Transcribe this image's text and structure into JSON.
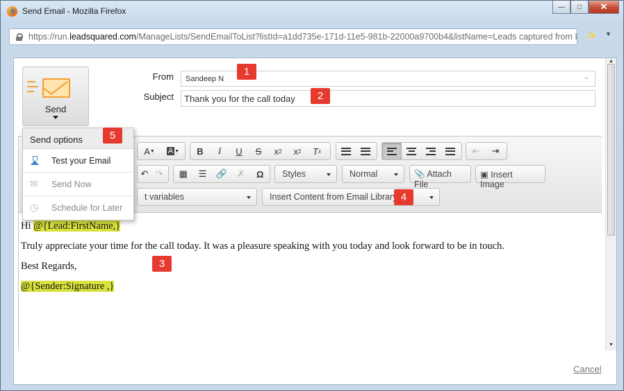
{
  "window": {
    "title": "Send Email - Mozilla Firefox",
    "url_scheme": "https://run.",
    "url_domain": "leadsquared.com",
    "url_path": "/ManageLists/SendEmailToList?listId=a1dd735e-171d-11e5-981b-22000a9700b4&listName=Leads captured from Inbour"
  },
  "send_button": {
    "label": "Send"
  },
  "form": {
    "from_label": "From",
    "from_value": "Sandeep N",
    "subject_label": "Subject",
    "subject_value": "Thank you for the call today"
  },
  "toolbar": {
    "styles_label": "Styles",
    "format_label": "Normal",
    "attach_label": "Attach File",
    "insert_image_label": "Insert Image",
    "variables_label": "t variables",
    "library_label": "Insert Content from Email Library"
  },
  "send_options": {
    "header": "Send options",
    "items": [
      "Test your Email",
      "Send Now",
      "Schedule for Later"
    ]
  },
  "body": {
    "greeting": "Hi ",
    "firstname_var": "@{Lead:FirstName,}",
    "line2": "Truly appreciate your time for the call today. It was a pleasure speaking with you today and look forward to be in touch.",
    "line3": "Best Regards,",
    "signature_var": "@{Sender:Signature ,}"
  },
  "footer": {
    "cancel_label": "Cancel"
  },
  "callouts": [
    "1",
    "2",
    "3",
    "4",
    "5"
  ],
  "colors": {
    "callout": "#e63a2f",
    "highlight": "#d8e23c",
    "accent": "#f0a030"
  }
}
